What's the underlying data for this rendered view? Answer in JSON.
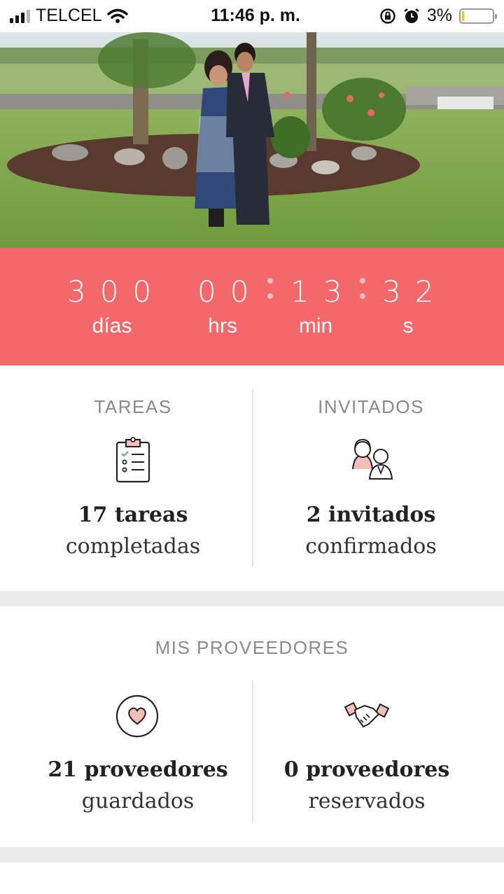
{
  "status_bar": {
    "carrier": "TELCEL",
    "time": "11:46 p. m.",
    "battery_percent": "3%",
    "battery_level": 0.03
  },
  "countdown": {
    "days": "300",
    "hours": "00",
    "minutes": "13",
    "seconds": "32",
    "days_label": "días",
    "hours_label": "hrs",
    "minutes_label": "min",
    "seconds_label": "s",
    "color": "#f4686b"
  },
  "summary": {
    "tasks": {
      "title": "TAREAS",
      "count": "17 tareas",
      "sub": "completadas",
      "icon": "clipboard-checklist-icon"
    },
    "guests": {
      "title": "INVITADOS",
      "count": "2 invitados",
      "sub": "confirmados",
      "icon": "couple-icon"
    }
  },
  "providers": {
    "title": "MIS PROVEEDORES",
    "saved": {
      "count": "21 proveedores",
      "sub": "guardados",
      "icon": "heart-circle-icon"
    },
    "booked": {
      "count": "0 proveedores",
      "sub": "reservados",
      "icon": "handshake-icon"
    }
  }
}
